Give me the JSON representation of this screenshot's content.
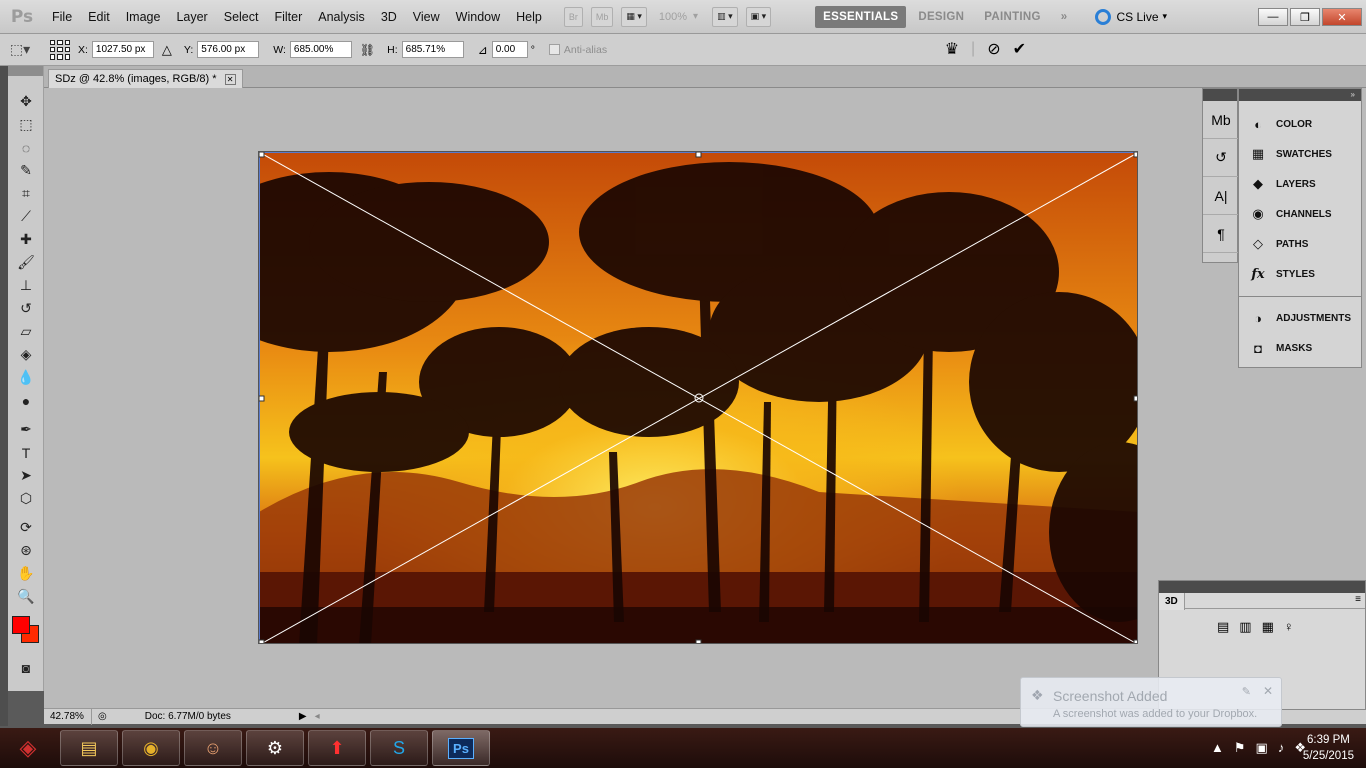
{
  "app": {
    "logo": "Ps",
    "menu": [
      "File",
      "Edit",
      "Image",
      "Layer",
      "Select",
      "Filter",
      "Analysis",
      "3D",
      "View",
      "Window",
      "Help"
    ],
    "bridge_label": "Br",
    "minibridge_label": "Mb",
    "zoom_dropdown": "100%",
    "workspaces": [
      "ESSENTIALS",
      "DESIGN",
      "PAINTING"
    ],
    "active_workspace": "ESSENTIALS",
    "cs_live": "CS Live"
  },
  "options": {
    "x_label": "X:",
    "x_value": "1027.50 px",
    "y_label": "Y:",
    "y_value": "576.00 px",
    "w_label": "W:",
    "w_value": "685.00%",
    "h_label": "H:",
    "h_value": "685.71%",
    "angle_value": "0.00",
    "degree": "°",
    "antialias": "Anti-alias"
  },
  "document": {
    "tab_title": "SDz @ 42.8% (images, RGB/8) *"
  },
  "status": {
    "zoom": "42.78%",
    "doc": "Doc: 6.77M/0 bytes"
  },
  "panels": {
    "items": [
      {
        "label": "COLOR",
        "icon": "color-icon"
      },
      {
        "label": "SWATCHES",
        "icon": "swatches-icon"
      },
      {
        "label": "LAYERS",
        "icon": "layers-icon"
      },
      {
        "label": "CHANNELS",
        "icon": "channels-icon"
      },
      {
        "label": "PATHS",
        "icon": "paths-icon"
      },
      {
        "label": "STYLES",
        "icon": "styles-icon"
      }
    ],
    "items2": [
      {
        "label": "ADJUSTMENTS",
        "icon": "adjustments-icon"
      },
      {
        "label": "MASKS",
        "icon": "masks-icon"
      }
    ],
    "panel3d_tab": "3D"
  },
  "toast": {
    "title": "Screenshot Added",
    "body": "A screenshot was added to your Dropbox."
  },
  "taskbar": {
    "time": "6:39 PM",
    "date": "5/25/2015",
    "ps_label": "Ps"
  },
  "colors": {
    "foreground": "#ff0000",
    "background": "#ff2a00"
  }
}
